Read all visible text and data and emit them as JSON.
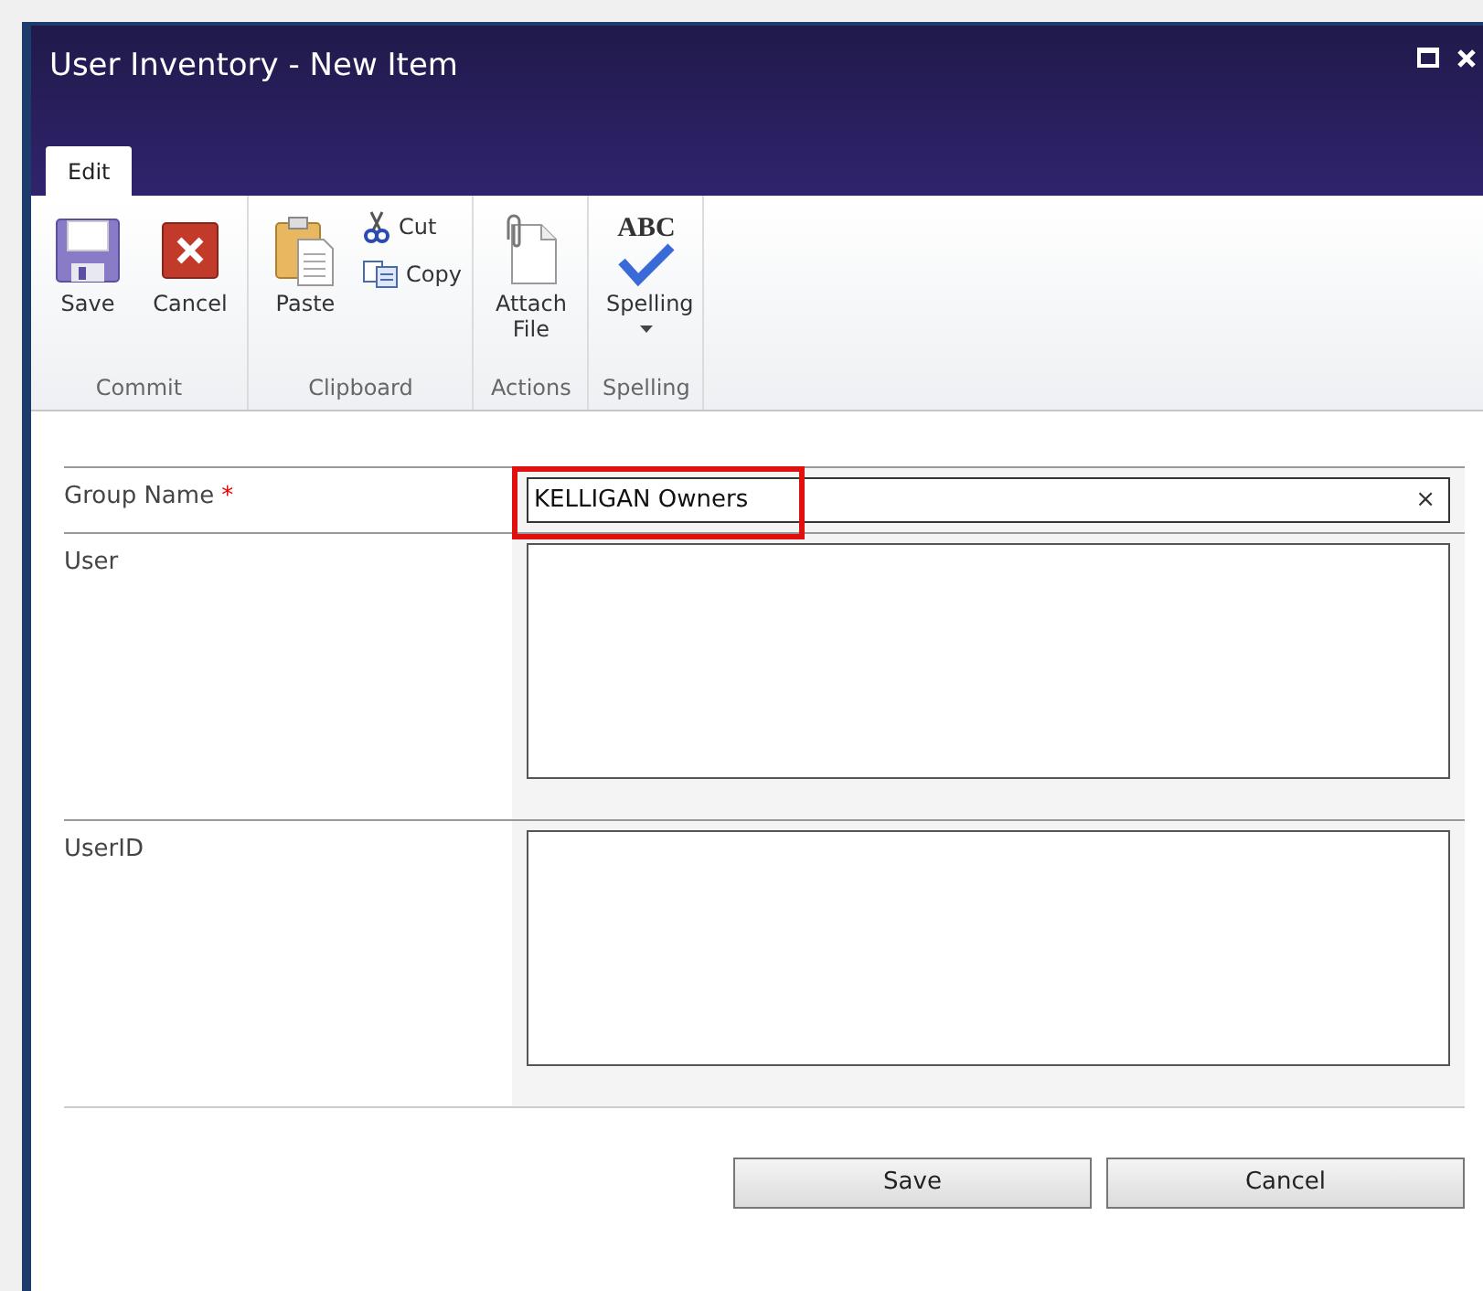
{
  "window": {
    "title": "User Inventory - New Item"
  },
  "tabs": [
    {
      "label": "Edit",
      "selected": true
    }
  ],
  "ribbon_groups": [
    {
      "label": "Commit",
      "buttons": [
        {
          "kind": "large",
          "label": "Save"
        },
        {
          "kind": "large",
          "label": "Cancel"
        }
      ]
    },
    {
      "label": "Clipboard",
      "buttons": [
        {
          "kind": "large",
          "label": "Paste"
        },
        {
          "kind": "small",
          "label": "Cut"
        },
        {
          "kind": "small",
          "label": "Copy"
        }
      ]
    },
    {
      "label": "Actions",
      "buttons": [
        {
          "kind": "large",
          "label": "Attach File"
        }
      ]
    },
    {
      "label": "Spelling",
      "buttons": [
        {
          "kind": "large",
          "icon_text": "ABC",
          "label": "Spelling",
          "dropdown": true
        }
      ]
    }
  ],
  "fields": [
    {
      "kind": "text",
      "label": "Group Name",
      "required_mark": "*",
      "value": "KELLIGAN Owners",
      "highlighted": true,
      "clear": "×"
    },
    {
      "kind": "textarea",
      "label": "User"
    },
    {
      "kind": "textarea",
      "label": "UserID"
    }
  ],
  "buttons": [
    "Save",
    "Cancel"
  ]
}
